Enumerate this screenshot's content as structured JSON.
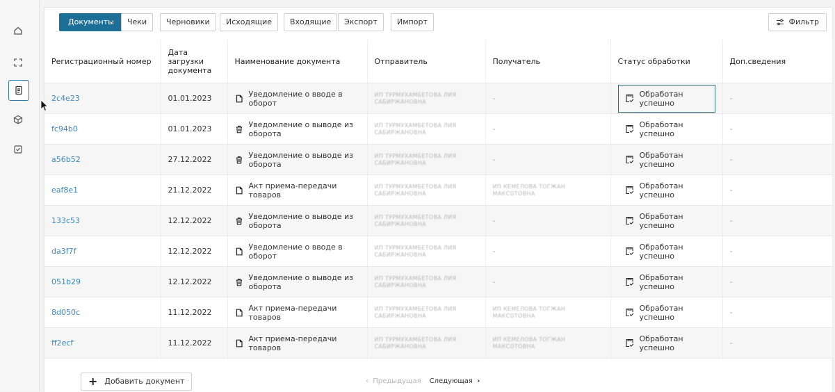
{
  "tabs": [
    {
      "label": "Документы"
    },
    {
      "label": "Чеки"
    },
    {
      "label": "Черновики"
    },
    {
      "label": "Исходящие"
    },
    {
      "label": "Входящие"
    },
    {
      "label": "Экспорт"
    },
    {
      "label": "Импорт"
    }
  ],
  "filter_label": "Фильтр",
  "columns": [
    "Регистрационный номер",
    "Дата загрузки документа",
    "Наименование документа",
    "Отправитель",
    "Получатель",
    "Статус обработки",
    "Доп.сведения"
  ],
  "rows": [
    {
      "reg": "2c4e23",
      "date": "01.01.2023",
      "doc": "Уведомление о вводе в оборот",
      "sender": "ИП ТУРМУХАМБЕТОВА ЛИЯ САБИРЖАНОВНА",
      "recipient": "-",
      "status": "Обработан успешно",
      "extra": "-"
    },
    {
      "reg": "fc94b0",
      "date": "01.01.2023",
      "doc": "Уведомление о выводе из оборота",
      "sender": "ИП ТУРМУХАМБЕТОВА ЛИЯ САБИРЖАНОВНА",
      "recipient": "-",
      "status": "Обработан успешно",
      "extra": "-"
    },
    {
      "reg": "a56b52",
      "date": "27.12.2022",
      "doc": "Уведомление о выводе из оборота",
      "sender": "ИП ТУРМУХАМБЕТОВА ЛИЯ САБИРЖАНОВНА",
      "recipient": "-",
      "status": "Обработан успешно",
      "extra": "-"
    },
    {
      "reg": "eaf8e1",
      "date": "21.12.2022",
      "doc": "Акт приема-передачи товаров",
      "sender": "ИП ТУРМУХАМБЕТОВА ЛИЯ САБИРЖАНОВНА",
      "recipient": "ИП КЕМЕЛОВА ТОГЖАН МАКСОТОВНА",
      "status": "Обработан успешно",
      "extra": "-"
    },
    {
      "reg": "133c53",
      "date": "12.12.2022",
      "doc": "Уведомление о выводе из оборота",
      "sender": "ИП ТУРМУХАМБЕТОВА ЛИЯ САБИРЖАНОВНА",
      "recipient": "-",
      "status": "Обработан успешно",
      "extra": "-"
    },
    {
      "reg": "da3f7f",
      "date": "12.12.2022",
      "doc": "Уведомление о вводе в оборот",
      "sender": "ИП ТУРМУХАМБЕТОВА ЛИЯ САБИРЖАНОВНА",
      "recipient": "-",
      "status": "Обработан успешно",
      "extra": "-"
    },
    {
      "reg": "051b29",
      "date": "12.12.2022",
      "doc": "Уведомление о выводе из оборота",
      "sender": "ИП ТУРМУХАМБЕТОВА ЛИЯ САБИРЖАНОВНА",
      "recipient": "-",
      "status": "Обработан успешно",
      "extra": "-"
    },
    {
      "reg": "8d050c",
      "date": "11.12.2022",
      "doc": "Акт приема-передачи товаров",
      "sender": "ИП ТУРМУХАМБЕТОВА ЛИЯ САБИРЖАНОВНА",
      "recipient": "ИП КЕМЕЛОВА ТОГЖАН МАКСОТОВНА",
      "status": "Обработан успешно",
      "extra": "-"
    },
    {
      "reg": "ff2ecf",
      "date": "11.12.2022",
      "doc": "Акт приема-передачи товаров",
      "sender": "ИП ТУРМУХАМБЕТОВА ЛИЯ САБИРЖАНОВНА",
      "recipient": "ИП КЕМЕЛОВА ТОГЖАН МАКСОТОВНА",
      "status": "Обработан успешно",
      "extra": "-"
    }
  ],
  "footer": {
    "add_label": "Добавить документ",
    "prev_label": "Предыдущая",
    "next_label": "Следующая"
  },
  "colors": {
    "accent": "#1c6f96",
    "link": "#3a89c3"
  }
}
